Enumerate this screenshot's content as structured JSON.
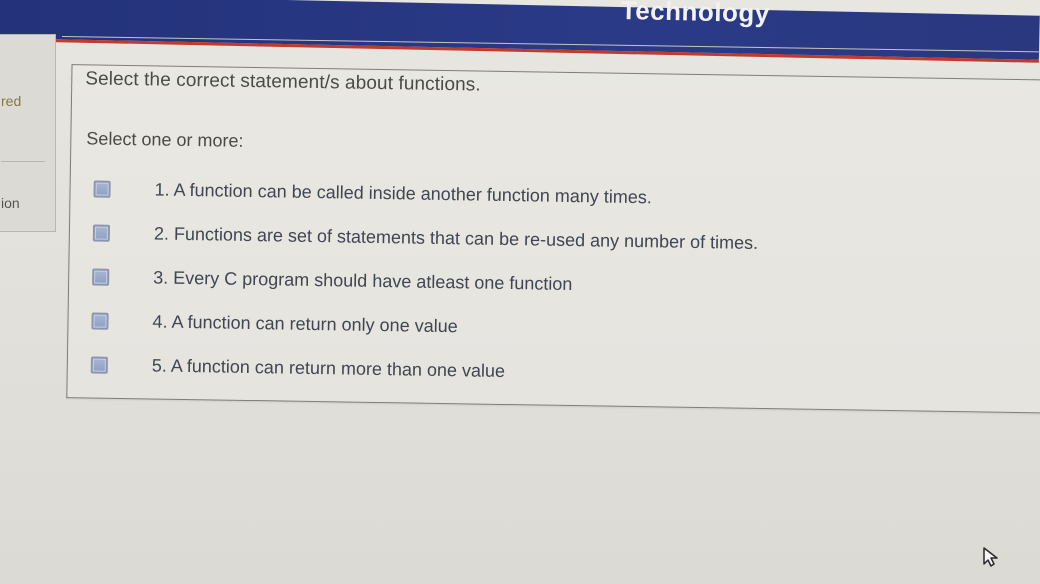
{
  "header": {
    "title": "Technology"
  },
  "sidebar": {
    "items": [
      {
        "label": "red"
      },
      {
        "label": "ion"
      }
    ]
  },
  "question": {
    "prompt": "Select the correct statement/s about functions.",
    "select_label": "Select one or more:",
    "options": [
      {
        "label": "1. A function can be called inside another function many times.",
        "checked": false
      },
      {
        "label": "2. Functions are set of statements that can be re-used any number of times.",
        "checked": false
      },
      {
        "label": "3. Every C program should have atleast one function",
        "checked": false
      },
      {
        "label": "4. A function can return only one value",
        "checked": false
      },
      {
        "label": "5. A function can return more than one value",
        "checked": false
      }
    ]
  },
  "colors": {
    "banner": "#2b3a87",
    "banner_accent": "#c23a2c",
    "checkbox": "#8ea0c4",
    "text": "#3f4652"
  },
  "icons": {
    "cursor": "mouse-pointer-icon"
  }
}
